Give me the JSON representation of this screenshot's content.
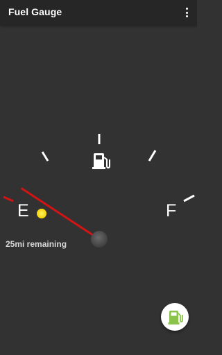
{
  "app_bar": {
    "title": "Fuel Gauge",
    "overflow_icon": "more-vert-icon"
  },
  "gauge": {
    "empty_label": "E",
    "full_label": "F",
    "fuel_level": 0.07,
    "center_icon": "fuel-pump-icon",
    "low_fuel_indicator_color": "#ffe000",
    "needle_color": "#d21414",
    "reserve_tick_color": "#d21414"
  },
  "status": {
    "remaining_text": "25mi remaining"
  },
  "fab": {
    "icon": "fuel-pump-icon",
    "color": "#8bc34a"
  }
}
